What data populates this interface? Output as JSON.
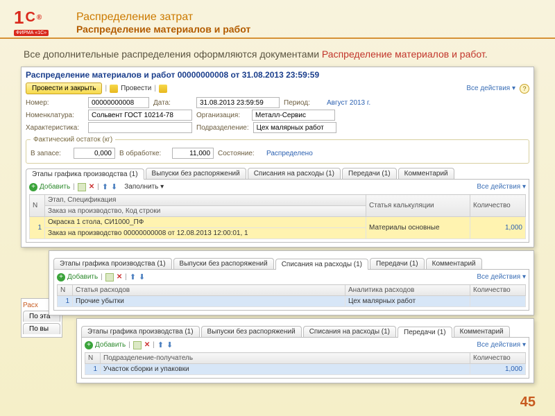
{
  "slide": {
    "title1": "Распределение затрат",
    "title2": "Распределение материалов и работ",
    "intro_pre": "Все дополнительные распределения оформляются документами ",
    "intro_hl": "Распределение материалов и работ",
    "intro_post": ".",
    "page": "45"
  },
  "win": {
    "title": "Распределение материалов и работ 00000000008 от 31.08.2013 23:59:59",
    "post_close": "Провести и закрыть",
    "post": "Провести",
    "all_actions": "Все действия ▾",
    "help": "?",
    "labels": {
      "number": "Номер:",
      "date": "Дата:",
      "period": "Период:",
      "item": "Номенклатура:",
      "org": "Организация:",
      "char": "Характеристика:",
      "dept": "Подразделение:",
      "stock": "В запасе:",
      "proc": "В обработке:",
      "state": "Состояние:"
    },
    "values": {
      "number": "00000000008",
      "date": "31.08.2013 23:59:59",
      "period": "Август 2013 г.",
      "item": "Сольвент ГОСТ 10214-78",
      "org": "Металл-Сервис",
      "dept": "Цех малярных работ",
      "stock": "0,000",
      "proc": "11,000",
      "state": "Распределено"
    },
    "legend": "Фактический остаток (кг)",
    "tabs": {
      "t1": "Этапы графика производства (1)",
      "t2": "Выпуски без распоряжений",
      "t3": "Списания на расходы (1)",
      "t4": "Передачи (1)",
      "t5": "Комментарий"
    },
    "tb": {
      "add": "Добавить",
      "fill": "Заполнить ▾",
      "all_actions": "Все действия ▾"
    },
    "grid1": {
      "h_n": "N",
      "h_stage": "Этап, Спецификация",
      "h_order": "Заказ на производство, Код строки",
      "h_article": "Статья калькуляции",
      "h_qty": "Количество",
      "r_n": "1",
      "r_stage": "Окраска 1 стола, СИ1000_ПФ",
      "r_order": "Заказ на производство 00000000008 от 12.08.2013 12:00:01, 1",
      "r_article": "Материалы основные",
      "r_qty": "1,000"
    },
    "grid2": {
      "h_n": "N",
      "h_exp": "Статья расходов",
      "h_an": "Аналитика расходов",
      "h_qty": "Количество",
      "r_n": "1",
      "r_exp": "Прочие убытки",
      "r_an": "Цех малярных работ"
    },
    "grid3": {
      "h_n": "N",
      "h_dept": "Подразделение-получатель",
      "h_qty": "Количество",
      "r_n": "1",
      "r_dept": "Участок сборки и упаковки",
      "r_qty": "1,000"
    },
    "side": {
      "l1": "Расх",
      "l2": "По эта",
      "l3": "По вы"
    }
  }
}
